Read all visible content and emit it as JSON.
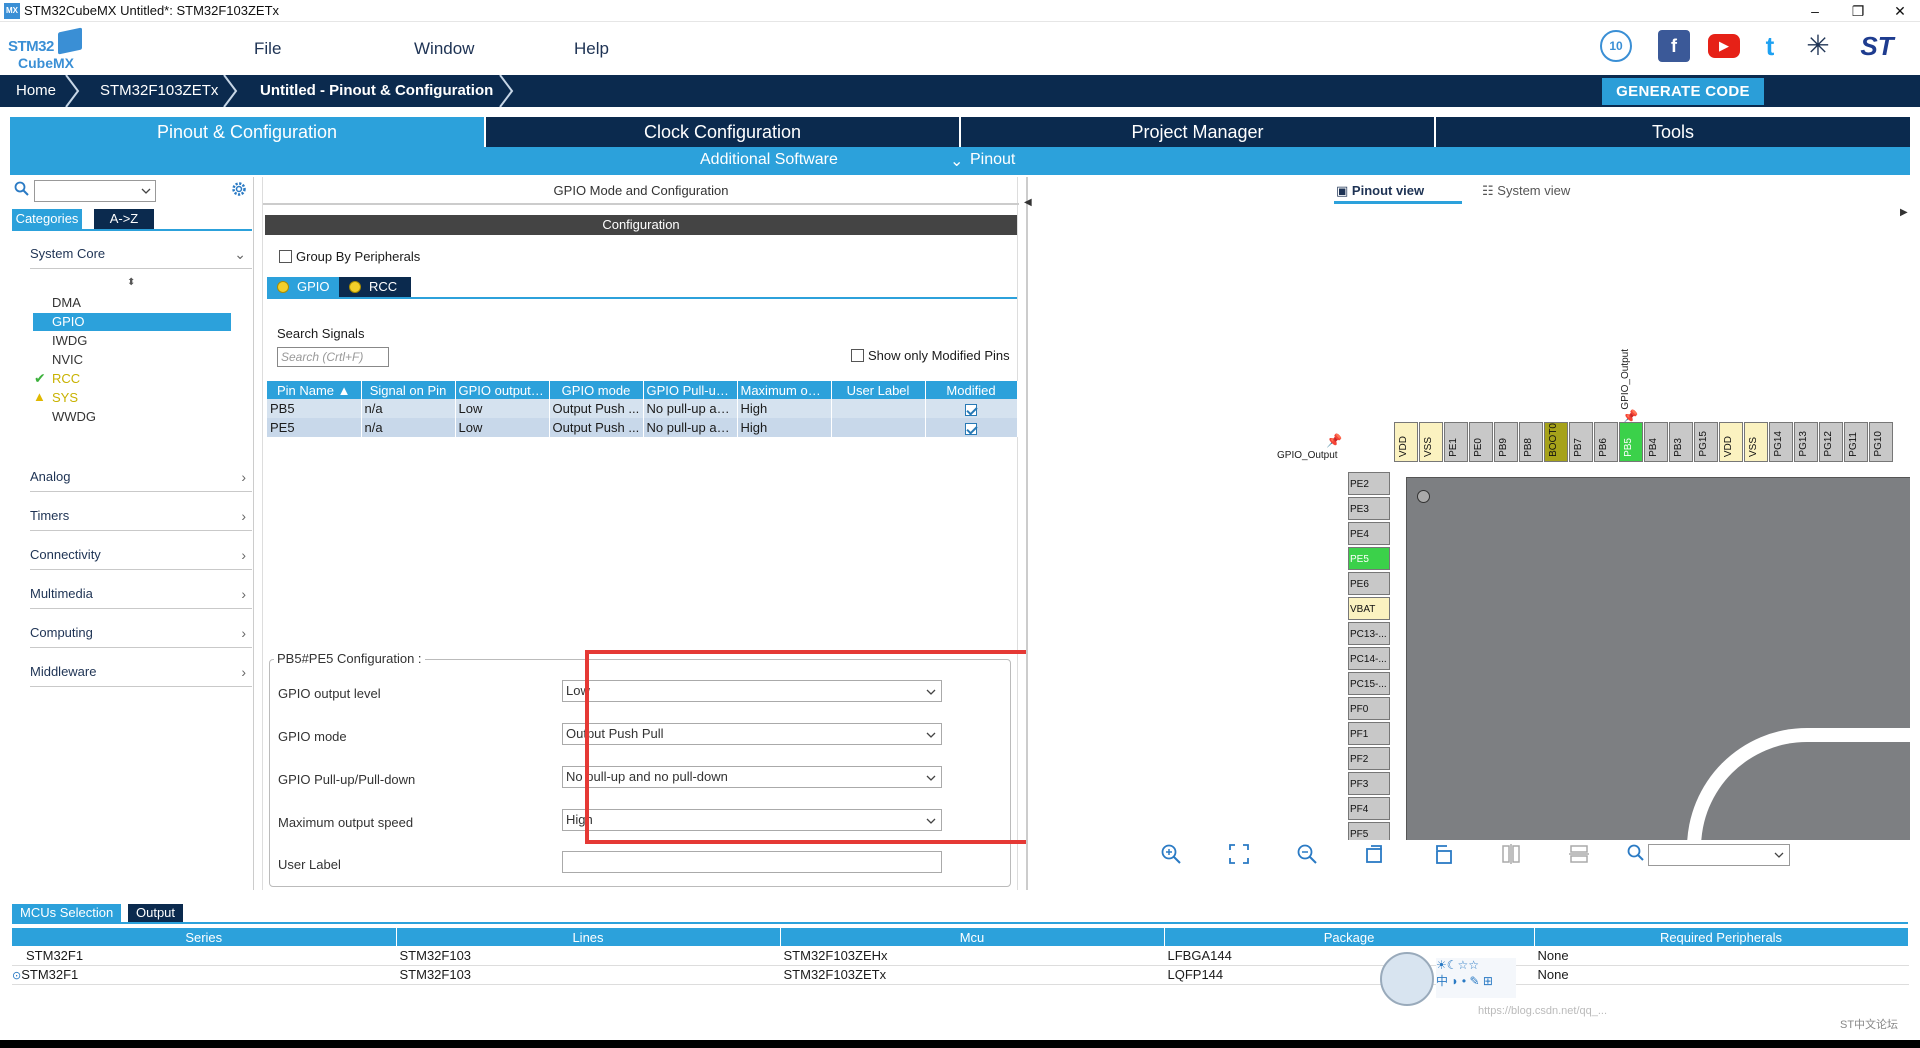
{
  "window": {
    "app_icon": "MX",
    "title": "STM32CubeMX Untitled*: STM32F103ZETx",
    "minimize": "–",
    "restore": "❐",
    "close": "✕"
  },
  "logo": {
    "line1": "STM32",
    "line2": "CubeMX"
  },
  "menu": {
    "file": "File",
    "window": "Window",
    "help": "Help"
  },
  "social": {
    "badge": "10",
    "facebook": "f",
    "youtube": "▶",
    "twitter": "t",
    "network": "✳",
    "st": "ST"
  },
  "breadcrumb": {
    "home": "Home",
    "mcu": "STM32F103ZETx",
    "current": "Untitled - Pinout & Configuration"
  },
  "generate_code": "GENERATE CODE",
  "main_tabs": [
    "Pinout & Configuration",
    "Clock Configuration",
    "Project Manager",
    "Tools"
  ],
  "sub_bar": {
    "additional_software": "Additional Software",
    "pinout": "Pinout"
  },
  "left": {
    "categories_tab": "Categories",
    "az_tab": "A->Z",
    "system_core": "System Core",
    "core_items": [
      "DMA",
      "GPIO",
      "IWDG",
      "NVIC",
      "RCC",
      "SYS",
      "WWDG"
    ],
    "sections": [
      "Analog",
      "Timers",
      "Connectivity",
      "Multimedia",
      "Computing",
      "Middleware"
    ],
    "sort_glyph": "⬍"
  },
  "middle": {
    "header": "GPIO Mode and Configuration",
    "configuration": "Configuration",
    "group_by": "Group By Peripherals",
    "tab_gpio": "GPIO",
    "tab_rcc": "RCC",
    "search_signals": "Search Signals",
    "search_placeholder": "Search (Crtl+F)",
    "show_modified": "Show only Modified Pins",
    "columns": [
      "Pin Name",
      "Signal on Pin",
      "GPIO output l...",
      "GPIO mode",
      "GPIO Pull-up/...",
      "Maximum out...",
      "User Label",
      "Modified"
    ],
    "rows": [
      [
        "PB5",
        "n/a",
        "Low",
        "Output Push ...",
        "No pull-up an...",
        "High",
        "",
        true
      ],
      [
        "PE5",
        "n/a",
        "Low",
        "Output Push ...",
        "No pull-up an...",
        "High",
        "",
        true
      ]
    ],
    "cfg_title": "PB5#PE5 Configuration :",
    "cfg_fields": [
      {
        "label": "GPIO output level",
        "value": "Low"
      },
      {
        "label": "GPIO mode",
        "value": "Output Push Pull"
      },
      {
        "label": "GPIO Pull-up/Pull-down",
        "value": "No pull-up and no pull-down"
      },
      {
        "label": "Maximum output speed",
        "value": "High"
      }
    ],
    "user_label": "User Label"
  },
  "right": {
    "pinout_view": "Pinout view",
    "system_view": "System view",
    "top_pins": [
      "VDD",
      "VSS",
      "PE1",
      "PE0",
      "PB9",
      "PB8",
      "BOOT0",
      "PB7",
      "PB6",
      "PB5",
      "PB4",
      "PB3",
      "PG15",
      "VDD",
      "VSS",
      "PG14",
      "PG13",
      "PG12",
      "PG11",
      "PG10"
    ],
    "left_pins": [
      "PE2",
      "PE3",
      "PE4",
      "PE5",
      "PE6",
      "VBAT",
      "PC13-...",
      "PC14-...",
      "PC15-...",
      "PF0",
      "PF1",
      "PF2",
      "PF3",
      "PF4",
      "PF5"
    ],
    "gpio_output_label": "GPIO_Output",
    "gpio_output_top": "GPIO_Output"
  },
  "bottom": {
    "tab_mcus": "MCUs Selection",
    "tab_output": "Output",
    "columns": [
      "Series",
      "Lines",
      "Mcu",
      "Package",
      "Required Peripherals"
    ],
    "rows": [
      [
        "STM32F1",
        "STM32F103",
        "STM32F103ZEHx",
        "LFBGA144",
        "None"
      ],
      [
        "STM32F1",
        "STM32F103",
        "STM32F103ZETx",
        "LQFP144",
        "None"
      ]
    ]
  },
  "watermark": {
    "url": "https://blog.csdn.net/qq_...",
    "forum": "ST中文论坛"
  }
}
